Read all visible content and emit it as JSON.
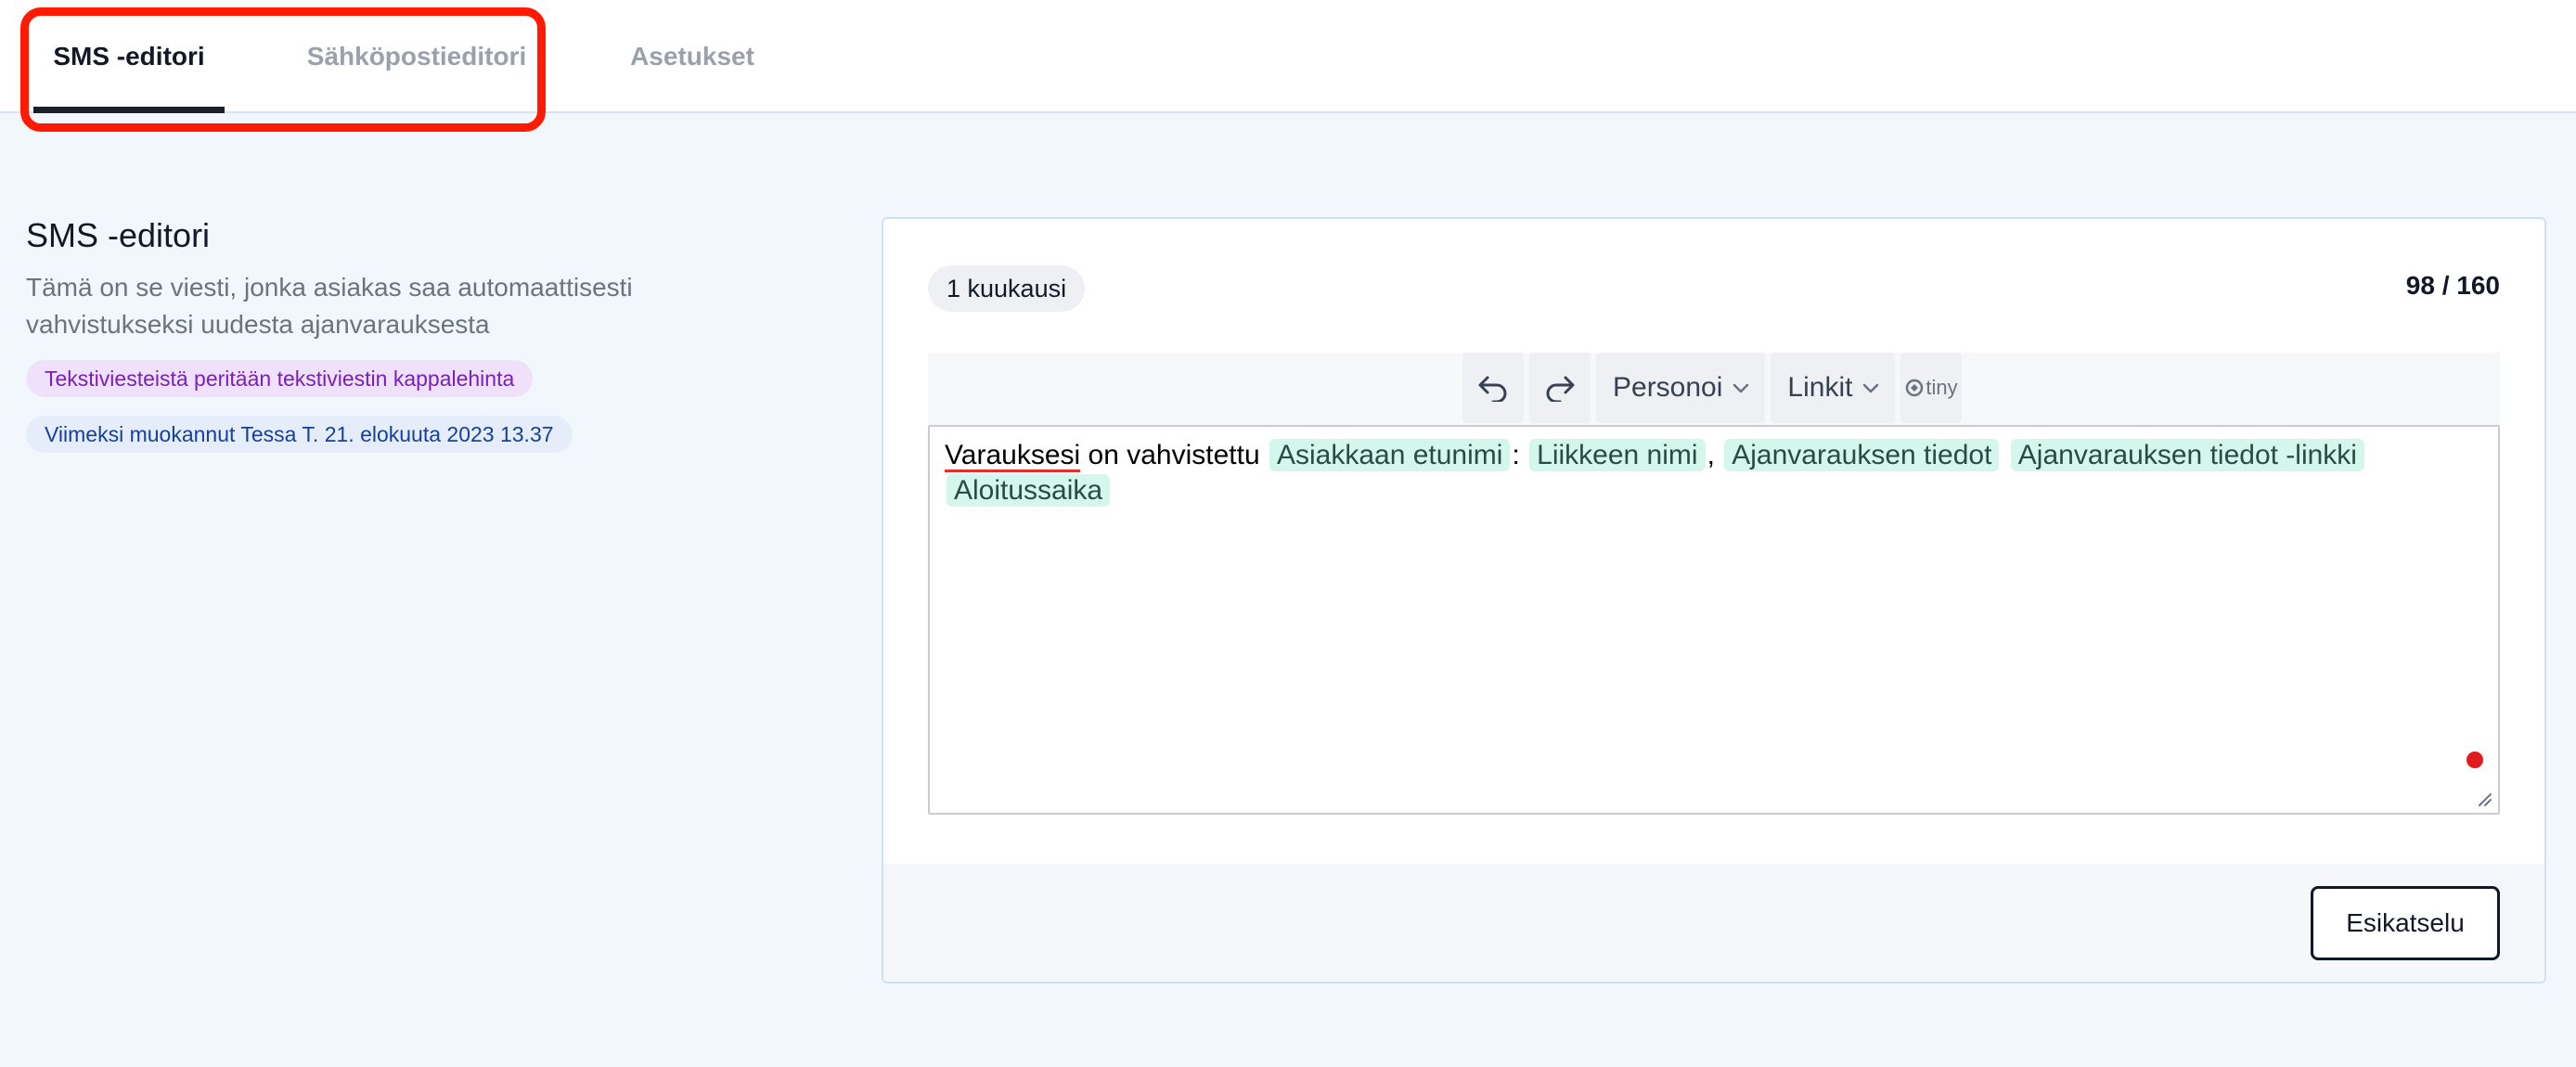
{
  "tabs": [
    {
      "label": "SMS -editori",
      "active": true
    },
    {
      "label": "Sähköpostieditori",
      "active": false
    },
    {
      "label": "Asetukset",
      "active": false
    }
  ],
  "section": {
    "title": "SMS -editori",
    "description": "Tämä on se viesti, jonka asiakas saa automaattisesti vahvistukseksi uudesta ajanvarauksesta",
    "price_note": "Tekstiviesteistä peritään tekstiviestin kappalehinta",
    "last_modified": "Viimeksi muokannut Tessa T. 21. elokuuta 2023 13.37"
  },
  "editor": {
    "period": "1 kuukausi",
    "counter": "98 / 160",
    "toolbar": {
      "undo_icon": "undo-icon",
      "redo_icon": "redo-icon",
      "personalize_label": "Personoi",
      "links_label": "Linkit",
      "brand_label": "tiny"
    },
    "content": {
      "word1": "Varauksesi",
      "text1": " on vahvistettu ",
      "tag1": "Asiakkaan etunimi",
      "sep1": ":",
      "tag2": "Liikkeen nimi",
      "sep2": ",",
      "tag3": "Ajanvarauksen tiedot",
      "tag4": "Ajanvarauksen tiedot -linkki",
      "tag5": "Aloitussaika"
    },
    "preview_label": "Esikatselu"
  },
  "colors": {
    "highlight": "#ff1a00",
    "tag_bg": "#d4f7ed",
    "price_pill_bg": "#efe1fb",
    "modified_pill_bg": "#e4edf9"
  }
}
